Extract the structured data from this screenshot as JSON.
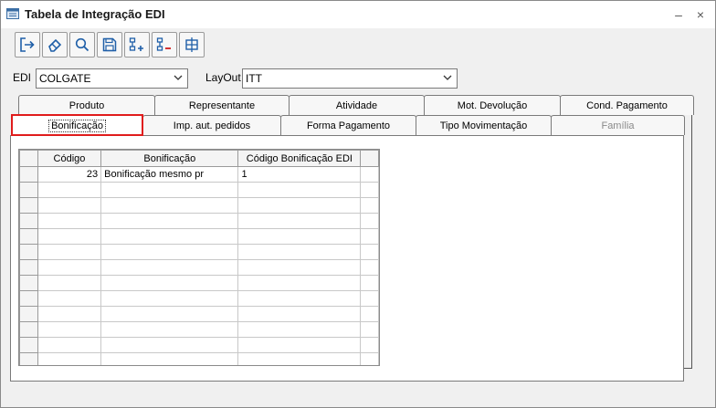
{
  "window": {
    "title": "Tabela de Integração EDI",
    "minimize_label": "–",
    "close_label": "×"
  },
  "toolbar": {
    "buttons": [
      {
        "name": "exit-icon"
      },
      {
        "name": "eraser-icon"
      },
      {
        "name": "search-icon"
      },
      {
        "name": "save-icon"
      },
      {
        "name": "add-row-icon"
      },
      {
        "name": "remove-row-icon"
      },
      {
        "name": "insert-row-icon"
      }
    ]
  },
  "filters": {
    "edi_label": "EDI",
    "edi_value": "COLGATE",
    "layout_label": "LayOut",
    "layout_value": "ITT"
  },
  "tabs_row1": [
    "Produto",
    "Representante",
    "Atividade",
    "Mot. Devolução",
    "Cond. Pagamento"
  ],
  "tabs_row2": [
    "Bonificação",
    "Imp. aut. pedidos",
    "Forma Pagamento",
    "Tipo Movimentação",
    "Família"
  ],
  "active_tab": "Bonificação",
  "grid": {
    "headers": [
      "Código",
      "Bonificação",
      "Código Bonificação EDI"
    ],
    "rows": [
      [
        "23",
        "Bonificação mesmo pr",
        "1"
      ]
    ]
  }
}
